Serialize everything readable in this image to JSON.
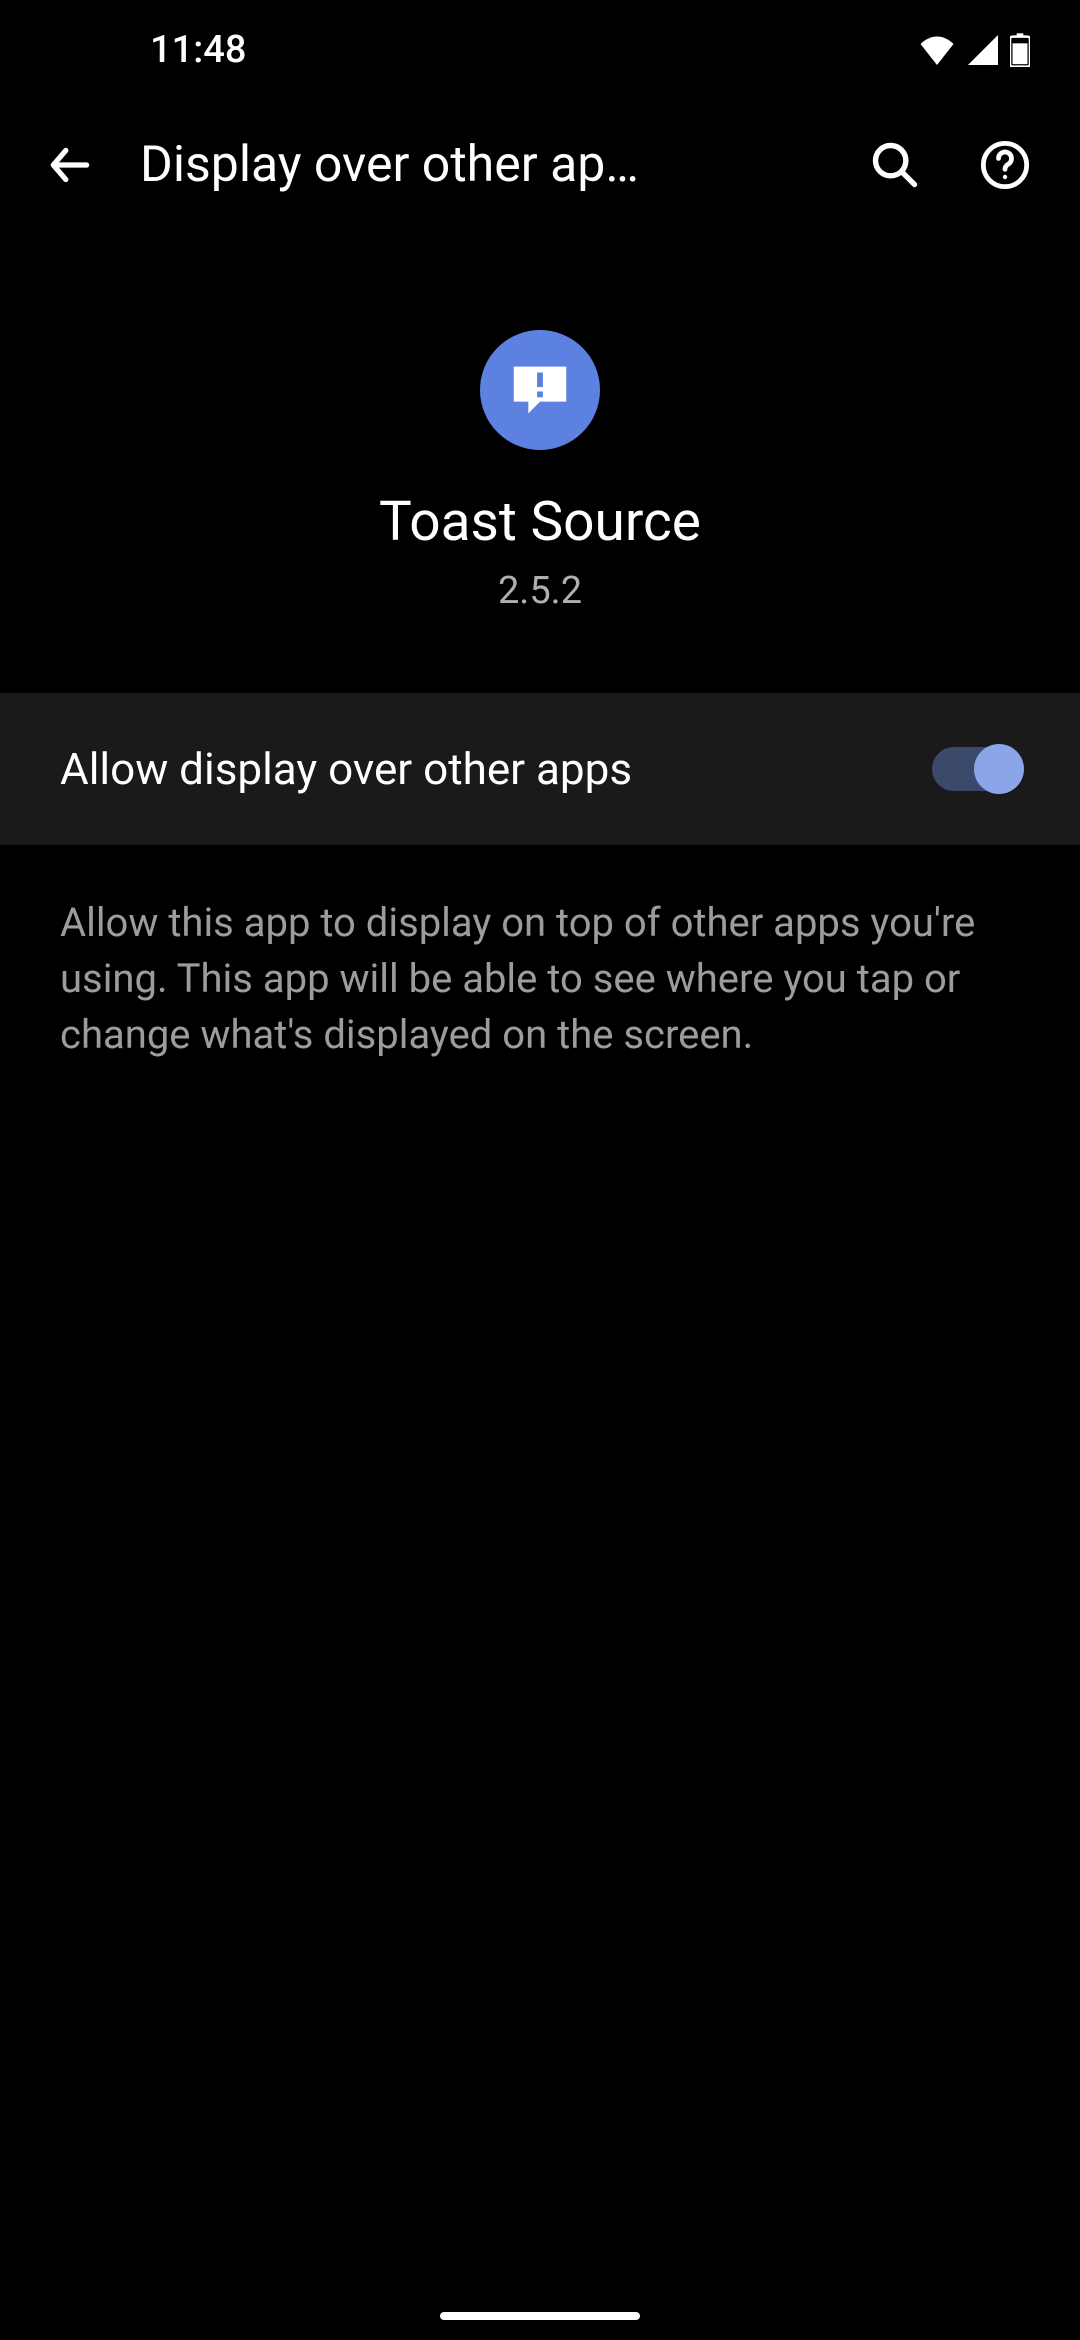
{
  "status_bar": {
    "time": "11:48"
  },
  "app_bar": {
    "title": "Display over other ap…"
  },
  "app_header": {
    "name": "Toast Source",
    "version": "2.5.2"
  },
  "setting": {
    "label": "Allow display over other apps",
    "enabled": true,
    "description": "Allow this app to display on top of other apps you're using. This app will be able to see where you tap or change what's displayed on the screen."
  }
}
